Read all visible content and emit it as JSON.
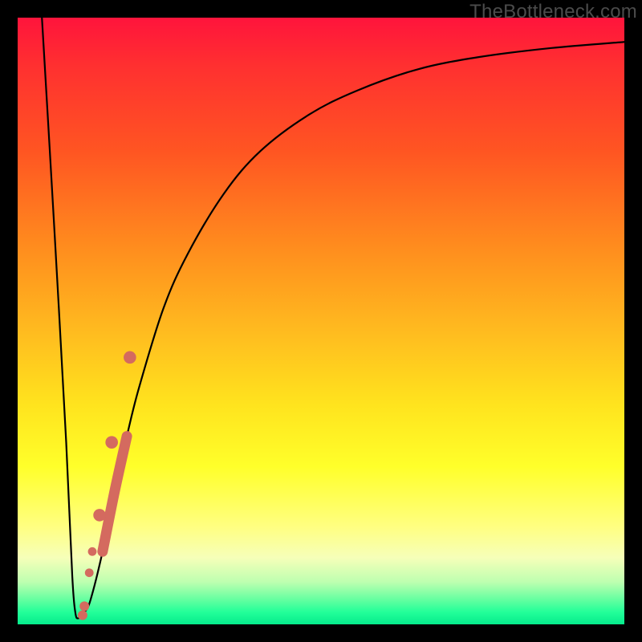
{
  "watermark": "TheBottleneck.com",
  "colors": {
    "frame": "#000000",
    "curve": "#000000",
    "marker": "#d46a5f"
  },
  "chart_data": {
    "type": "line",
    "title": "",
    "xlabel": "",
    "ylabel": "",
    "xlim": [
      0,
      100
    ],
    "ylim": [
      0,
      100
    ],
    "grid": false,
    "series": [
      {
        "name": "bottleneck-curve",
        "x": [
          4,
          6,
          8,
          9,
          9.5,
          10,
          11,
          12,
          14,
          16,
          18,
          20,
          24,
          28,
          34,
          40,
          48,
          56,
          66,
          76,
          88,
          100
        ],
        "y": [
          100,
          66,
          30,
          8,
          2,
          1,
          2,
          4,
          12,
          22,
          31,
          39,
          52,
          61,
          71,
          78,
          84,
          88,
          91.5,
          93.5,
          95,
          96
        ]
      }
    ],
    "markers": [
      {
        "name": "thick-segment-top",
        "x": 18.5,
        "y": 44,
        "r": 1.3
      },
      {
        "name": "thick-segment-mid",
        "x": 15.5,
        "y": 30,
        "r": 1.3
      },
      {
        "name": "thick-segment-bottom",
        "x": 13.5,
        "y": 18,
        "r": 1.3
      },
      {
        "name": "dot-upper",
        "x": 12.3,
        "y": 12,
        "r": 0.9
      },
      {
        "name": "dot-lower",
        "x": 11.8,
        "y": 8.5,
        "r": 0.9
      },
      {
        "name": "baseline-dot-1",
        "x": 11.0,
        "y": 3.0,
        "r": 1.0
      },
      {
        "name": "baseline-dot-2",
        "x": 10.7,
        "y": 1.5,
        "r": 1.0
      }
    ]
  }
}
